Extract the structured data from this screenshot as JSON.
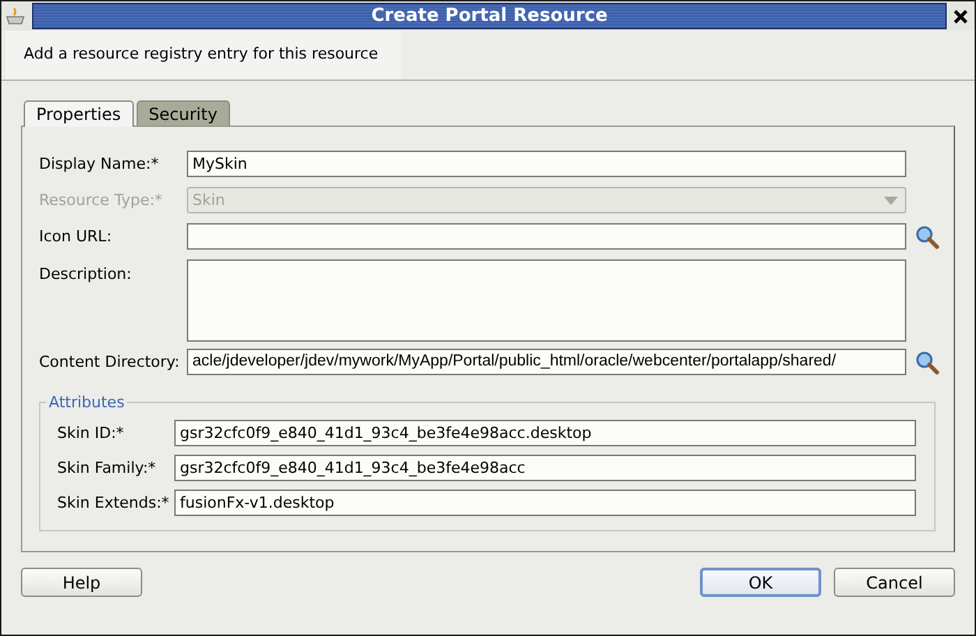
{
  "window": {
    "title": "Create Portal Resource"
  },
  "description": "Add a resource registry entry for this resource",
  "tabs": [
    {
      "label": "Properties",
      "selected": true
    },
    {
      "label": "Security",
      "selected": false
    }
  ],
  "fields": [
    {
      "kind": "text",
      "label": "Display Name:*",
      "value": "MySkin",
      "disabled": false,
      "browse": false
    },
    {
      "kind": "combo",
      "label": "Resource Type:*",
      "value": "Skin",
      "disabled": true,
      "browse": false
    },
    {
      "kind": "text",
      "label": "Icon URL:",
      "disabled": false,
      "browse": true
    },
    {
      "kind": "area",
      "label": "Description:",
      "disabled": false,
      "browse": false
    },
    {
      "kind": "path",
      "label": "Content Directory:",
      "value": "acle/jdeveloper/jdev/mywork/MyApp/Portal/public_html/oracle/webcenter/portalapp/shared/",
      "disabled": false,
      "browse": true
    }
  ],
  "attributes": {
    "title": "Attributes",
    "fields": [
      {
        "label": "Skin ID:*",
        "value": "gsr32cfc0f9_e840_41d1_93c4_be3fe4e98acc.desktop"
      },
      {
        "label": "Skin Family:*",
        "value": "gsr32cfc0f9_e840_41d1_93c4_be3fe4e98acc"
      },
      {
        "label": "Skin Extends:*",
        "value": "fusionFx-v1.desktop"
      }
    ]
  },
  "buttons": [
    {
      "label": "Help",
      "default": false
    },
    {
      "label": "OK",
      "default": true
    },
    {
      "label": "Cancel",
      "default": false
    }
  ]
}
